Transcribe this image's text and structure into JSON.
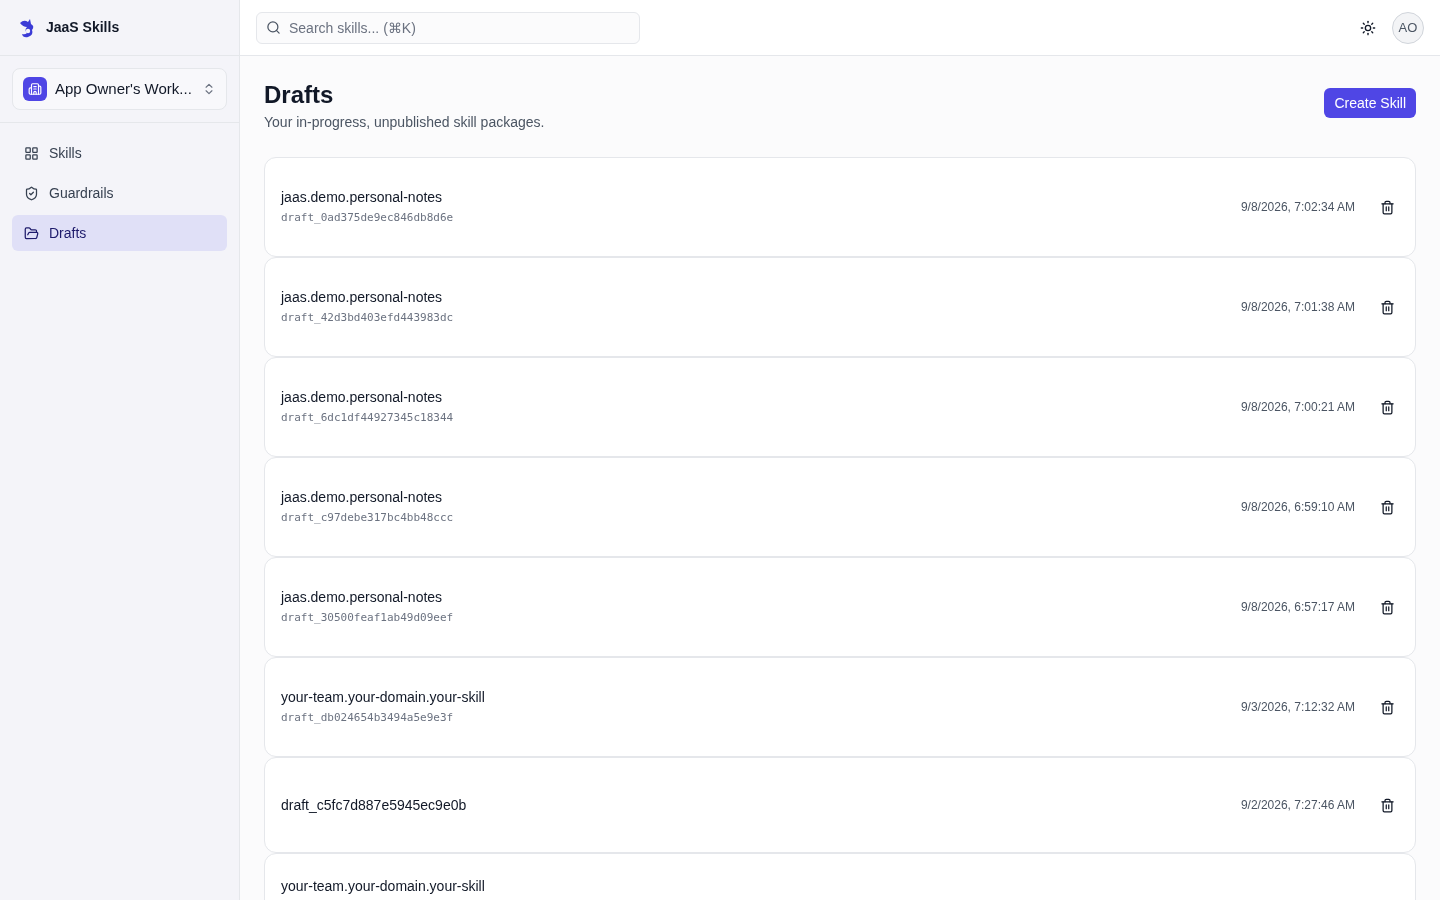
{
  "brand": {
    "name": "JaaS Skills"
  },
  "workspace": {
    "label": "App Owner's Work..."
  },
  "nav": [
    {
      "label": "Skills",
      "selected": false
    },
    {
      "label": "Guardrails",
      "selected": false
    },
    {
      "label": "Drafts",
      "selected": true
    }
  ],
  "search": {
    "placeholder": "Search skills... (⌘K)"
  },
  "user": {
    "initials": "AO"
  },
  "page": {
    "title": "Drafts",
    "subtitle": "Your in-progress, unpublished skill packages.",
    "action": "Create Skill"
  },
  "drafts": [
    {
      "name": "jaas.demo.personal-notes",
      "draft_id": "draft_0ad375de9ec846db8d6e",
      "time": "9/8/2026, 7:02:34 AM"
    },
    {
      "name": "jaas.demo.personal-notes",
      "draft_id": "draft_42d3bd403efd443983dc",
      "time": "9/8/2026, 7:01:38 AM"
    },
    {
      "name": "jaas.demo.personal-notes",
      "draft_id": "draft_6dc1df44927345c18344",
      "time": "9/8/2026, 7:00:21 AM"
    },
    {
      "name": "jaas.demo.personal-notes",
      "draft_id": "draft_c97debe317bc4bb48ccc",
      "time": "9/8/2026, 6:59:10 AM"
    },
    {
      "name": "jaas.demo.personal-notes",
      "draft_id": "draft_30500feaf1ab49d09eef",
      "time": "9/8/2026, 6:57:17 AM"
    },
    {
      "name": "your-team.your-domain.your-skill",
      "draft_id": "draft_db024654b3494a5e9e3f",
      "time": "9/3/2026, 7:12:32 AM"
    },
    {
      "name": "draft_c5fc7d887e5945ec9e0b",
      "time": "9/2/2026, 7:27:46 AM"
    },
    {
      "name": "your-team.your-domain.your-skill"
    }
  ]
}
